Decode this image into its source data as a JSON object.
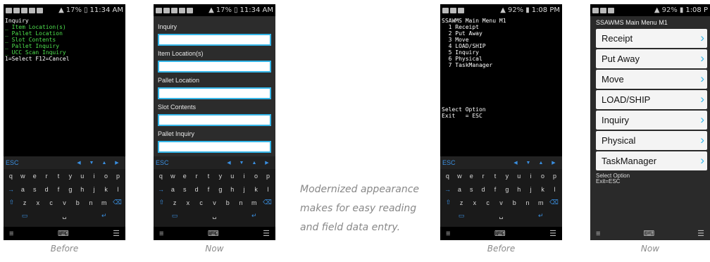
{
  "panel1": {
    "status_time": "11:34 AM",
    "status_batt": "17%",
    "terminal_lines": [
      {
        "text": "Inquiry",
        "green": false
      },
      {
        "text": "_ Item Location(s)",
        "green": true
      },
      {
        "text": "_ Pallet Location",
        "green": true
      },
      {
        "text": "_ Slot Contents",
        "green": true
      },
      {
        "text": "_ Pallet Inquiry",
        "green": true
      },
      {
        "text": "_ UCC Scan Inquiry",
        "green": true
      },
      {
        "text": "1=Select F12=Cancel",
        "green": false
      }
    ],
    "caption": "Before"
  },
  "panel2": {
    "status_time": "11:34 AM",
    "status_batt": "17%",
    "fields": [
      {
        "label": "Inquiry"
      },
      {
        "label": "Item Location(s)"
      },
      {
        "label": "Pallet Location"
      },
      {
        "label": "Slot Contents"
      },
      {
        "label": "Pallet Inquiry"
      }
    ],
    "caption": "Now"
  },
  "panel3": {
    "status_time": "1:08 PM",
    "status_batt": "92%",
    "terminal_lines": [
      {
        "text": "SSAWMS Main Menu M1"
      },
      {
        "text": "  1 Receipt"
      },
      {
        "text": "  2 Put Away"
      },
      {
        "text": "  3 Move"
      },
      {
        "text": "  4 LOAD/SHIP"
      },
      {
        "text": "  5 Inquiry"
      },
      {
        "text": "  6 Physical"
      },
      {
        "text": "  7 TaskManager"
      },
      {
        "text": ""
      },
      {
        "text": ""
      },
      {
        "text": ""
      },
      {
        "text": ""
      },
      {
        "text": ""
      },
      {
        "text": ""
      },
      {
        "text": "Select Option"
      },
      {
        "text": "Exit   = ESC"
      }
    ],
    "caption": "Before"
  },
  "panel4": {
    "status_time": "1:08 P",
    "status_batt": "92%",
    "title": "SSAWMS Main Menu M1",
    "items": [
      {
        "label": "Receipt"
      },
      {
        "label": "Put Away"
      },
      {
        "label": "Move"
      },
      {
        "label": "LOAD/SHIP"
      },
      {
        "label": "Inquiry"
      },
      {
        "label": "Physical"
      },
      {
        "label": "TaskManager"
      }
    ],
    "foot1": "Select Option",
    "foot2": "Exit=ESC",
    "caption": "Now"
  },
  "keyboard": {
    "esc": "ESC",
    "row1": [
      "q",
      "w",
      "e",
      "r",
      "t",
      "y",
      "u",
      "i",
      "o",
      "p"
    ],
    "row2": [
      "→",
      "a",
      "s",
      "d",
      "f",
      "g",
      "h",
      "j",
      "k",
      "l"
    ],
    "row3": [
      "⇧",
      "z",
      "x",
      "c",
      "v",
      "b",
      "n",
      "m",
      "⌫"
    ]
  },
  "blurb": "Modernized appearance makes for easy reading and field data entry.",
  "icons": {
    "signal": "signal-icon",
    "battery": "battery-icon",
    "menu": "menu-icon",
    "keyboard": "keyboard-icon",
    "chevron": "chevron-right-icon"
  },
  "colors": {
    "accent": "#35b6e8",
    "terminal_green": "#4ee04e",
    "keyboard_blue": "#3a8fe0",
    "caption_gray": "#8a8a8a"
  }
}
